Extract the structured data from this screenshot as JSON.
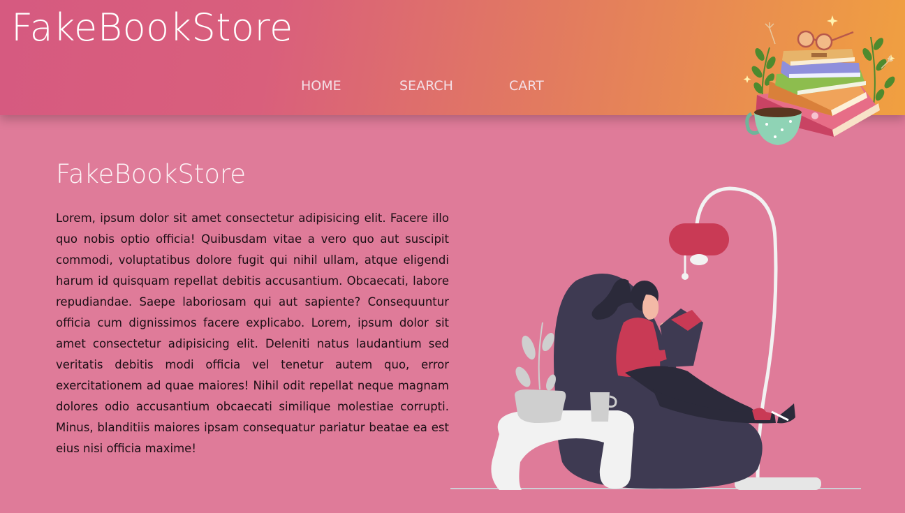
{
  "header": {
    "brand": "FakeBookStore",
    "nav": [
      {
        "label": "HOME"
      },
      {
        "label": "SEARCH"
      },
      {
        "label": "CART"
      }
    ],
    "gradient_colors": [
      "#d65a80",
      "#f0a040"
    ]
  },
  "main": {
    "title": "FakeBookStore",
    "body": "Lorem, ipsum dolor sit amet consectetur adipisicing elit. Facere illo quo nobis optio officia! Quibusdam vitae a vero quo aut suscipit commodi, voluptatibus dolore fugit qui nihil ullam, atque eligendi harum id quisquam repellat debitis accusantium. Obcaecati, labore repudiandae. Saepe laboriosam qui aut sapiente? Consequuntur officia cum dignissimos facere explicabo. Lorem, ipsum dolor sit amet consectetur adipisicing elit. Deleniti natus laudantium sed veritatis debitis modi officia vel tenetur autem quo, error exercitationem ad quae maiores! Nihil odit repellat neque magnam dolores odio accusantium obcaecati similique molestiae corrupti. Minus, blanditiis maiores ipsam consequatur pariatur beatae ea est eius nisi officia maxime!"
  },
  "colors": {
    "page_background": "#df7b99",
    "accent_red": "#c93a55",
    "dark_chair": "#3e3a52"
  },
  "illustrations": {
    "header_art": "stack-of-books-with-glasses-and-teacup",
    "main_art": "woman-reading-on-beanbag-under-floor-lamp"
  }
}
